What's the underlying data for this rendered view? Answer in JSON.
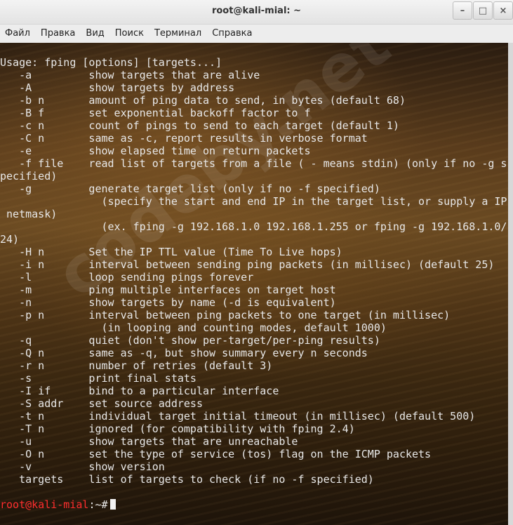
{
  "window": {
    "title": "root@kali-mial: ~",
    "buttons": {
      "minimize": "–",
      "maximize": "□",
      "close": "×"
    }
  },
  "menu": [
    "Файл",
    "Правка",
    "Вид",
    "Поиск",
    "Терминал",
    "Справка"
  ],
  "watermark": "codeby.net",
  "terminal": {
    "lines": [
      "Usage: fping [options] [targets...]",
      "   -a         show targets that are alive",
      "   -A         show targets by address",
      "   -b n       amount of ping data to send, in bytes (default 68)",
      "   -B f       set exponential backoff factor to f",
      "   -c n       count of pings to send to each target (default 1)",
      "   -C n       same as -c, report results in verbose format",
      "   -e         show elapsed time on return packets",
      "   -f file    read list of targets from a file ( - means stdin) (only if no -g s",
      "pecified)",
      "   -g         generate target list (only if no -f specified)",
      "                (specify the start and end IP in the target list, or supply a IP",
      " netmask)",
      "                (ex. fping -g 192.168.1.0 192.168.1.255 or fping -g 192.168.1.0/",
      "24)",
      "   -H n       Set the IP TTL value (Time To Live hops)",
      "   -i n       interval between sending ping packets (in millisec) (default 25)",
      "   -l         loop sending pings forever",
      "   -m         ping multiple interfaces on target host",
      "   -n         show targets by name (-d is equivalent)",
      "   -p n       interval between ping packets to one target (in millisec)",
      "                (in looping and counting modes, default 1000)",
      "   -q         quiet (don't show per-target/per-ping results)",
      "   -Q n       same as -q, but show summary every n seconds",
      "   -r n       number of retries (default 3)",
      "   -s         print final stats",
      "   -I if      bind to a particular interface",
      "   -S addr    set source address",
      "   -t n       individual target initial timeout (in millisec) (default 500)",
      "   -T n       ignored (for compatibility with fping 2.4)",
      "   -u         show targets that are unreachable",
      "   -O n       set the type of service (tos) flag on the ICMP packets",
      "   -v         show version",
      "   targets    list of targets to check (if no -f specified)",
      ""
    ],
    "prompt": {
      "user_host": "root@kali-mial",
      "path_suffix": ":~# "
    }
  },
  "colors": {
    "prompt": "#ff2e2e",
    "text": "#e8e8e8",
    "titlebar": "#ededed"
  }
}
